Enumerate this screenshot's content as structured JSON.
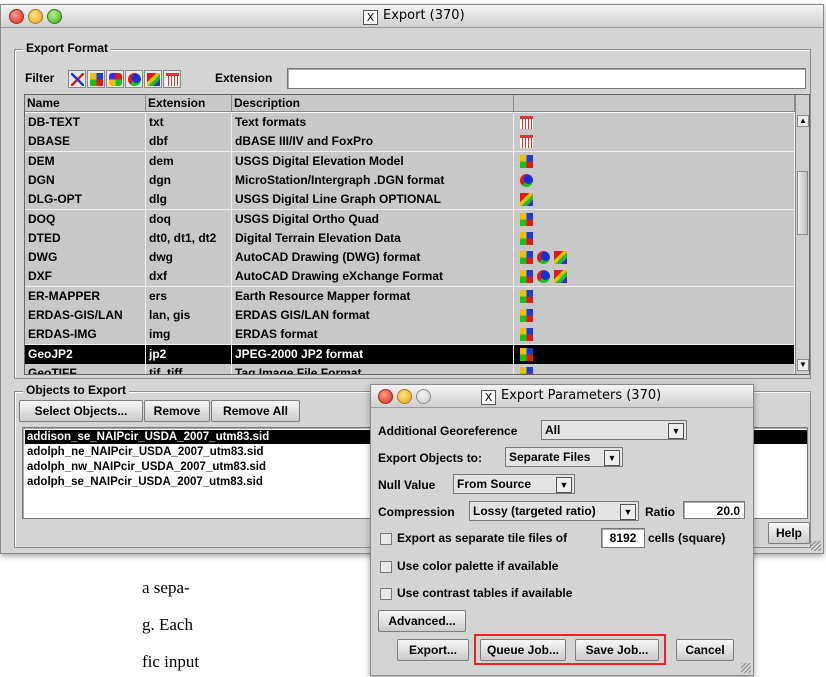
{
  "export_window": {
    "title": "Export (370)",
    "export_format_label": "Export Format",
    "filter_label": "Filter",
    "filter_icons": [
      "all-formats-icon",
      "raster-icon",
      "raster-vector-icon",
      "vector-icon",
      "cad-icon",
      "text-database-icon"
    ],
    "extension_label": "Extension",
    "extension_value": "",
    "columns": [
      "Name",
      "Extension",
      "Description"
    ],
    "rows": [
      {
        "name": "DB-TEXT",
        "ext": "txt",
        "desc": "Text formats",
        "icons": [
          "text"
        ]
      },
      {
        "name": "DBASE",
        "ext": "dbf",
        "desc": "dBASE III/IV and FoxPro",
        "icons": [
          "text"
        ]
      },
      {
        "name": "DEM",
        "ext": "dem",
        "desc": "USGS Digital Elevation Model",
        "icons": [
          "raster"
        ]
      },
      {
        "name": "DGN",
        "ext": "dgn",
        "desc": "MicroStation/Intergraph .DGN format",
        "icons": [
          "vector"
        ]
      },
      {
        "name": "DLG-OPT",
        "ext": "dlg",
        "desc": "USGS Digital Line Graph OPTIONAL",
        "icons": [
          "cad"
        ]
      },
      {
        "name": "DOQ",
        "ext": "doq",
        "desc": "USGS Digital Ortho Quad",
        "icons": [
          "raster"
        ]
      },
      {
        "name": "DTED",
        "ext": "dt0, dt1, dt2",
        "desc": "Digital Terrain Elevation Data",
        "icons": [
          "raster"
        ]
      },
      {
        "name": "DWG",
        "ext": "dwg",
        "desc": "AutoCAD Drawing (DWG) format",
        "icons": [
          "raster",
          "vector",
          "cad"
        ]
      },
      {
        "name": "DXF",
        "ext": "dxf",
        "desc": "AutoCAD Drawing eXchange Format",
        "icons": [
          "raster",
          "vector",
          "cad"
        ]
      },
      {
        "name": "ER-MAPPER",
        "ext": "ers",
        "desc": "Earth Resource Mapper format",
        "icons": [
          "raster"
        ]
      },
      {
        "name": "ERDAS-GIS/LAN",
        "ext": "lan, gis",
        "desc": "ERDAS GIS/LAN format",
        "icons": [
          "raster"
        ]
      },
      {
        "name": "ERDAS-IMG",
        "ext": "img",
        "desc": "ERDAS format",
        "icons": [
          "raster"
        ]
      },
      {
        "name": "GeoJP2",
        "ext": "jp2",
        "desc": "JPEG-2000 JP2 format",
        "icons": [
          "raster"
        ],
        "selected": true
      },
      {
        "name": "GeoTIFF",
        "ext": "tif, tiff",
        "desc": "Tag Image File Format",
        "icons": [
          "raster"
        ]
      }
    ],
    "objects_label": "Objects to Export",
    "select_objects_label": "Select Objects...",
    "remove_label": "Remove",
    "remove_all_label": "Remove All",
    "objects": [
      "addison_se_NAIPcir_USDA_2007_utm83.sid",
      "adolph_ne_NAIPcir_USDA_2007_utm83.sid",
      "adolph_nw_NAIPcir_USDA_2007_utm83.sid",
      "adolph_se_NAIPcir_USDA_2007_utm83.sid"
    ],
    "help_label": "Help"
  },
  "params_window": {
    "title": "Export Parameters (370)",
    "georef_label": "Additional Georeference",
    "georef_value": "All",
    "export_objects_label": "Export Objects to:",
    "export_objects_value": "Separate Files",
    "null_label": "Null Value",
    "null_value": "From Source",
    "compression_label": "Compression",
    "compression_value": "Lossy (targeted ratio)",
    "ratio_label": "Ratio",
    "ratio_value": "20.0",
    "tile_label_a": "Export as separate tile files of",
    "tile_value": "8192",
    "tile_label_b": "cells (square)",
    "palette_label": "Use color palette if available",
    "contrast_label": "Use contrast tables if available",
    "advanced_label": "Advanced...",
    "export_label": "Export...",
    "queue_label": "Queue Job...",
    "save_label": "Save Job...",
    "cancel_label": "Cancel",
    "highlight_color": "#e8262a"
  },
  "page_text": {
    "line1": "a sepa-",
    "line2": "g.  Each",
    "line3": "fic input"
  }
}
